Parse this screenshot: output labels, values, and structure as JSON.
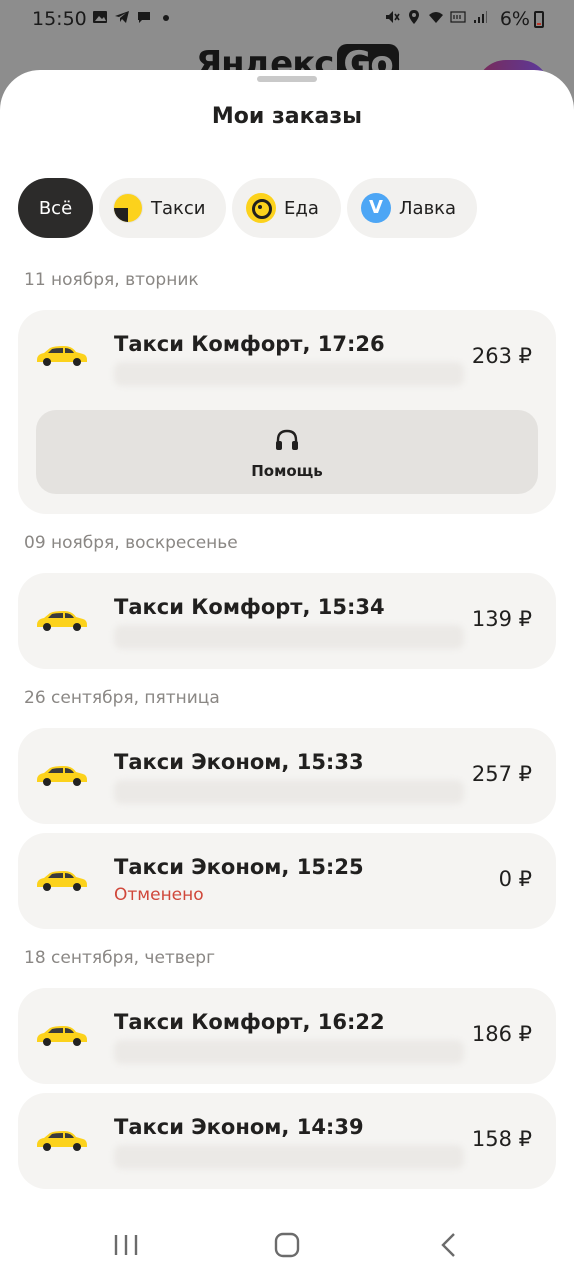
{
  "status_bar": {
    "time": "15:50",
    "battery": "6%",
    "left_icons": [
      "gallery-icon",
      "telegram-icon",
      "chat-icon",
      "dot-icon"
    ],
    "right_icons": [
      "mute-icon",
      "location-icon",
      "wifi-icon",
      "volte-icon",
      "signal-icon",
      "battery-icon"
    ]
  },
  "background": {
    "logo_text": "Яндекс",
    "logo_badge": "Go"
  },
  "sheet": {
    "title": "Мои заказы"
  },
  "filters": [
    {
      "label": "Всё",
      "active": true
    },
    {
      "label": "Такси",
      "icon": "taxi-icon"
    },
    {
      "label": "Еда",
      "icon": "eda-icon"
    },
    {
      "label": "Лавка",
      "icon": "lavka-icon"
    }
  ],
  "groups": [
    {
      "date": "11 ноября, вторник"
    },
    {
      "date": "09 ноября, воскресенье"
    },
    {
      "date": "26 сентября, пятница"
    },
    {
      "date": "18 сентября, четверг"
    }
  ],
  "orders": [
    {
      "title": "Такси Комфорт, 17:26",
      "price": "263 ₽",
      "help_label": "Помощь"
    },
    {
      "title": "Такси Комфорт, 15:34",
      "price": "139 ₽"
    },
    {
      "title": "Такси Эконом, 15:33",
      "price": "257 ₽"
    },
    {
      "title": "Такси Эконом, 15:25",
      "price": "0 ₽",
      "status": "Отменено"
    },
    {
      "title": "Такси Комфорт, 16:22",
      "price": "186 ₽"
    },
    {
      "title": "Такси Эконом, 14:39",
      "price": "158 ₽"
    }
  ],
  "colors": {
    "accent_yellow": "#fcd21c",
    "cancelled_red": "#d0473a",
    "chip_active": "#2c2b2a",
    "card_bg": "#f5f4f2"
  }
}
